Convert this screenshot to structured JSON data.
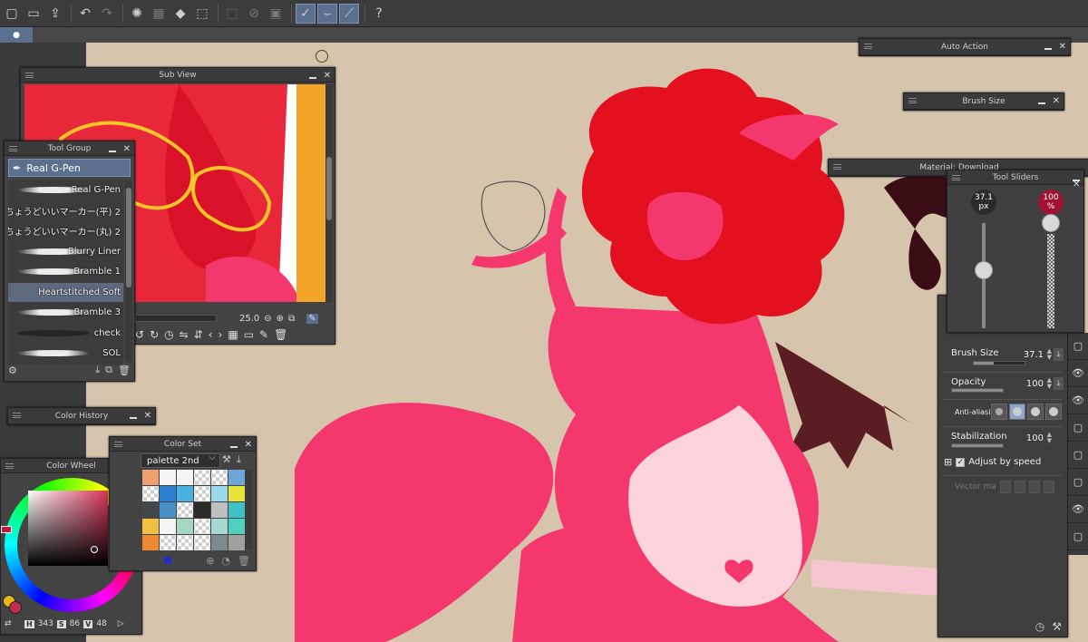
{
  "toolbar": {
    "icons": [
      "new-file",
      "open-folder",
      "export",
      "undo",
      "redo",
      "clear",
      "fill-bucket",
      "transform",
      "select-all",
      "deselect",
      "invert",
      "pen-tool-1",
      "pen-tool-2",
      "pen-tool-3",
      "help"
    ],
    "tab_glyph": "●"
  },
  "subview": {
    "title": "Sub View",
    "zoom": "25.0"
  },
  "tool_group": {
    "title": "Tool Group",
    "active_tool": "Real G-Pen",
    "brushes": [
      {
        "label": "Real G-Pen"
      },
      {
        "label": "ちょうどいいマーカー(平) 2"
      },
      {
        "label": "ちょうどいいマーカー(丸) 2"
      },
      {
        "label": "Blurry Liner"
      },
      {
        "label": "Bramble 1"
      },
      {
        "label": "Heartstitched Soft"
      },
      {
        "label": "Bramble 3"
      },
      {
        "label": "check"
      },
      {
        "label": "SOL"
      }
    ]
  },
  "color_history": {
    "title": "Color History"
  },
  "color_wheel": {
    "title": "Color Wheel",
    "h_label": "H",
    "h": "343",
    "s_label": "S",
    "s": "86",
    "v_label": "V",
    "v": "48",
    "main_color": "#e8b61c",
    "sub_color": "#bf2e4e"
  },
  "color_set": {
    "title": "Color Set",
    "palette": "palette 2nd",
    "swatches": [
      "#f0a070",
      "#f4f4f4",
      "#f4f4f4",
      "chk",
      "chk",
      "#6fa6d8",
      "chk",
      "#2c7fd1",
      "#4ab0e0",
      "chk",
      "#9ad9ea",
      "#e6e43c",
      "#44474a",
      "#4a90c8",
      "chk",
      "#2b2b2b",
      "#bfbfbf",
      "#3fc0c8",
      "#f0c040",
      "#f4f4f4",
      "#a5d8c0",
      "chk",
      "#a5d8d0",
      "#4fd0c0",
      "#f08a30",
      "chk",
      "chk",
      "chk",
      "#7c8a90",
      "#a0a0a0"
    ]
  },
  "auto_action": {
    "title": "Auto Action"
  },
  "brush_size": {
    "title": "Brush Size"
  },
  "material": {
    "title": "Material: Download"
  },
  "tool_sliders": {
    "title": "Tool Sliders",
    "size_value": "37.1",
    "size_unit": "px",
    "opacity_value": "100",
    "opacity_unit": "%",
    "size_level": 0.55,
    "opacity_level": 1.0
  },
  "tool_property": {
    "brush_size_label": "Brush Size",
    "brush_size": "37.1",
    "opacity_label": "Opacity",
    "opacity": "100",
    "antialias_label": "Anti-aliasing",
    "stabilization_label": "Stabilization",
    "stabilization": "100",
    "adjust_speed_label": "Adjust by speed",
    "vector_label": "Vector ma"
  },
  "colors": {
    "canvas_bg": "#d6c4ad",
    "skin": "#f4386e",
    "hair": "#e3101f",
    "belly": "#fbd3dc",
    "accent": "#5b6f8f"
  }
}
